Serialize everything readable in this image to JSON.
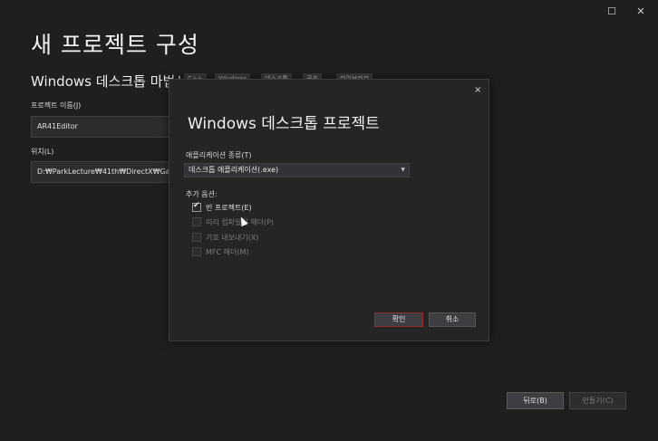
{
  "window": {
    "minimize_icon": "minimize-icon",
    "maximize_icon": "maximize-icon",
    "maximize_glyph": "☐"
  },
  "page": {
    "title": "새 프로젝트 구성",
    "subtitle": "Windows 데스크톱 마법사",
    "tags": [
      "C++",
      "Windows",
      "데스크톱",
      "콘솔",
      "라이브러리"
    ],
    "project_name_label": "프로젝트 이름(J)",
    "project_name_value": "AR41Editor",
    "location_label": "위치(L)",
    "location_value": "D:₩ParkLecture₩41th₩DirectX₩Game"
  },
  "dialog": {
    "close_glyph": "×",
    "title": "Windows 데스크톱 프로젝트",
    "app_type_label": "애플리케이션 종류(T)",
    "app_type_value": "데스크톱 애플리케이션(.exe)",
    "extra_options_label": "추가 옵션:",
    "options": [
      {
        "label": "빈 프로젝트(E)",
        "checked": true,
        "enabled": true
      },
      {
        "label": "미리 컴파일된 헤더(P)",
        "checked": false,
        "enabled": false
      },
      {
        "label": "기호 내보내기(X)",
        "checked": false,
        "enabled": false
      },
      {
        "label": "MFC 헤더(M)",
        "checked": false,
        "enabled": false
      }
    ],
    "ok_label": "확인",
    "cancel_label": "취소"
  },
  "footer": {
    "back_label": "뒤로(B)",
    "create_label": "만들기(C)"
  },
  "colors": {
    "background": "#1f1f1f",
    "dialog_bg": "#252526",
    "ok_border": "#9a2b2b"
  }
}
